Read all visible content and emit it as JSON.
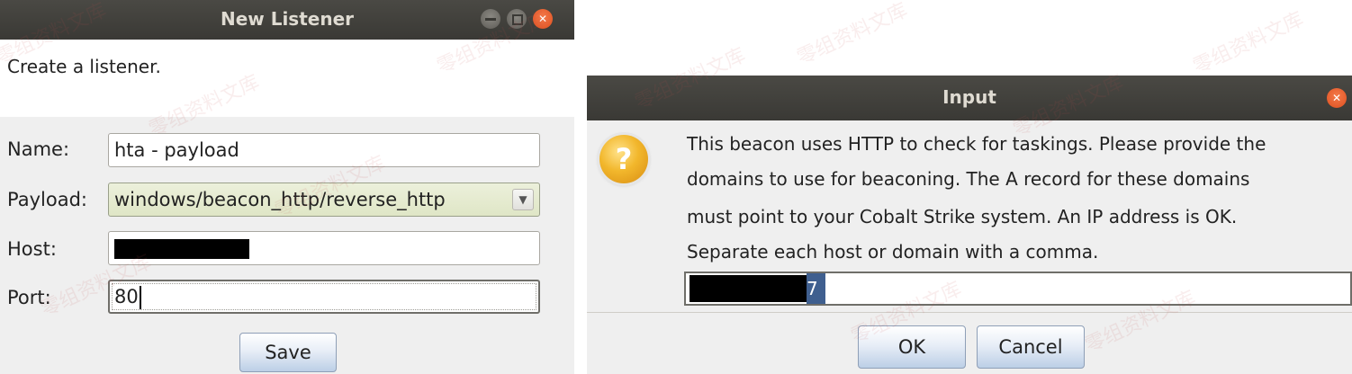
{
  "new_listener": {
    "title": "New Listener",
    "description": "Create a listener.",
    "fields": {
      "name_label": "Name:",
      "name_value": "hta - payload",
      "payload_label": "Payload:",
      "payload_value": "windows/beacon_http/reverse_http",
      "host_label": "Host:",
      "host_value": "",
      "port_label": "Port:",
      "port_value": "80"
    },
    "save_label": "Save"
  },
  "input_dialog": {
    "title": "Input",
    "message_lines": [
      "This beacon uses HTTP to check for taskings. Please provide the",
      "domains to use for beaconing. The A record for these domains",
      "must point to your Cobalt Strike system. An IP address is OK.",
      "Separate each host or domain with a comma."
    ],
    "input_value_visible": "7",
    "ok_label": "OK",
    "cancel_label": "Cancel"
  },
  "watermark_text": "零组资料文库",
  "colors": {
    "titlebar": "#3d3c38",
    "close_button": "#e4572a",
    "button_gradient_bottom": "#bccfe6",
    "combo_background": "#e6ebd0"
  },
  "icons": {
    "question": "question-mark-icon",
    "close": "close-icon",
    "minimize": "minimize-icon",
    "maximize": "maximize-icon",
    "dropdown": "chevron-down-icon"
  }
}
